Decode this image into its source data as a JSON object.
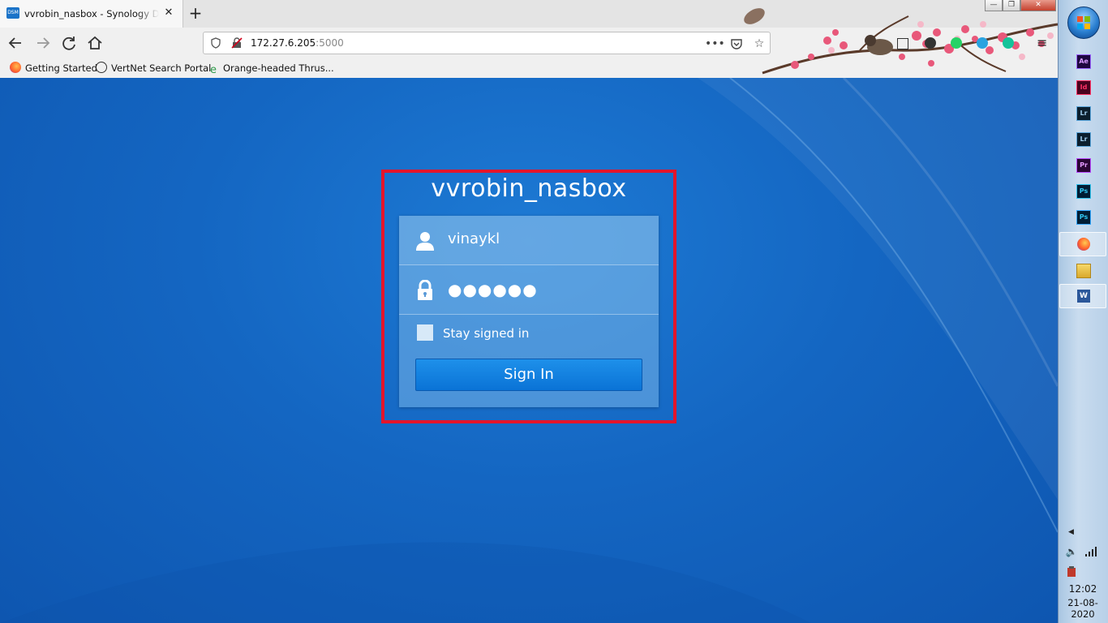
{
  "browser": {
    "tab": {
      "favicon_text": "DSM",
      "title": "vvrobin_nasbox - Synology DiskStation"
    },
    "address_bar": {
      "host": "172.27.6.205",
      "port": ":5000"
    },
    "bookmarks": [
      {
        "label": "Getting Started",
        "icon": "firefox-icon"
      },
      {
        "label": "VertNet Search Portal",
        "icon": "globe-icon"
      },
      {
        "label": "Orange-headed Thrus...",
        "icon": "e-icon"
      }
    ]
  },
  "login": {
    "title": "vvrobin_nasbox",
    "username": "vinaykl",
    "password_mask": "●●●●●●",
    "stay_signed_in_label": "Stay signed in",
    "stay_signed_in_checked": false,
    "sign_in_label": "Sign In",
    "highlight_color": "#e3152b"
  },
  "taskbar": {
    "apps": [
      {
        "label": "Ae",
        "name": "after-effects-icon"
      },
      {
        "label": "Id",
        "name": "indesign-icon"
      },
      {
        "label": "Lr",
        "name": "lightroom-icon"
      },
      {
        "label": "Lr",
        "name": "lightroom-classic-icon"
      },
      {
        "label": "Pr",
        "name": "premiere-icon"
      },
      {
        "label": "Ps",
        "name": "photoshop-icon"
      },
      {
        "label": "Ps",
        "name": "photoshop-alt-icon"
      },
      {
        "label": "",
        "name": "firefox-icon"
      },
      {
        "label": "",
        "name": "file-explorer-icon"
      },
      {
        "label": "W",
        "name": "word-icon"
      }
    ],
    "clock": {
      "time": "12:02",
      "date": "21-08-2020"
    }
  }
}
